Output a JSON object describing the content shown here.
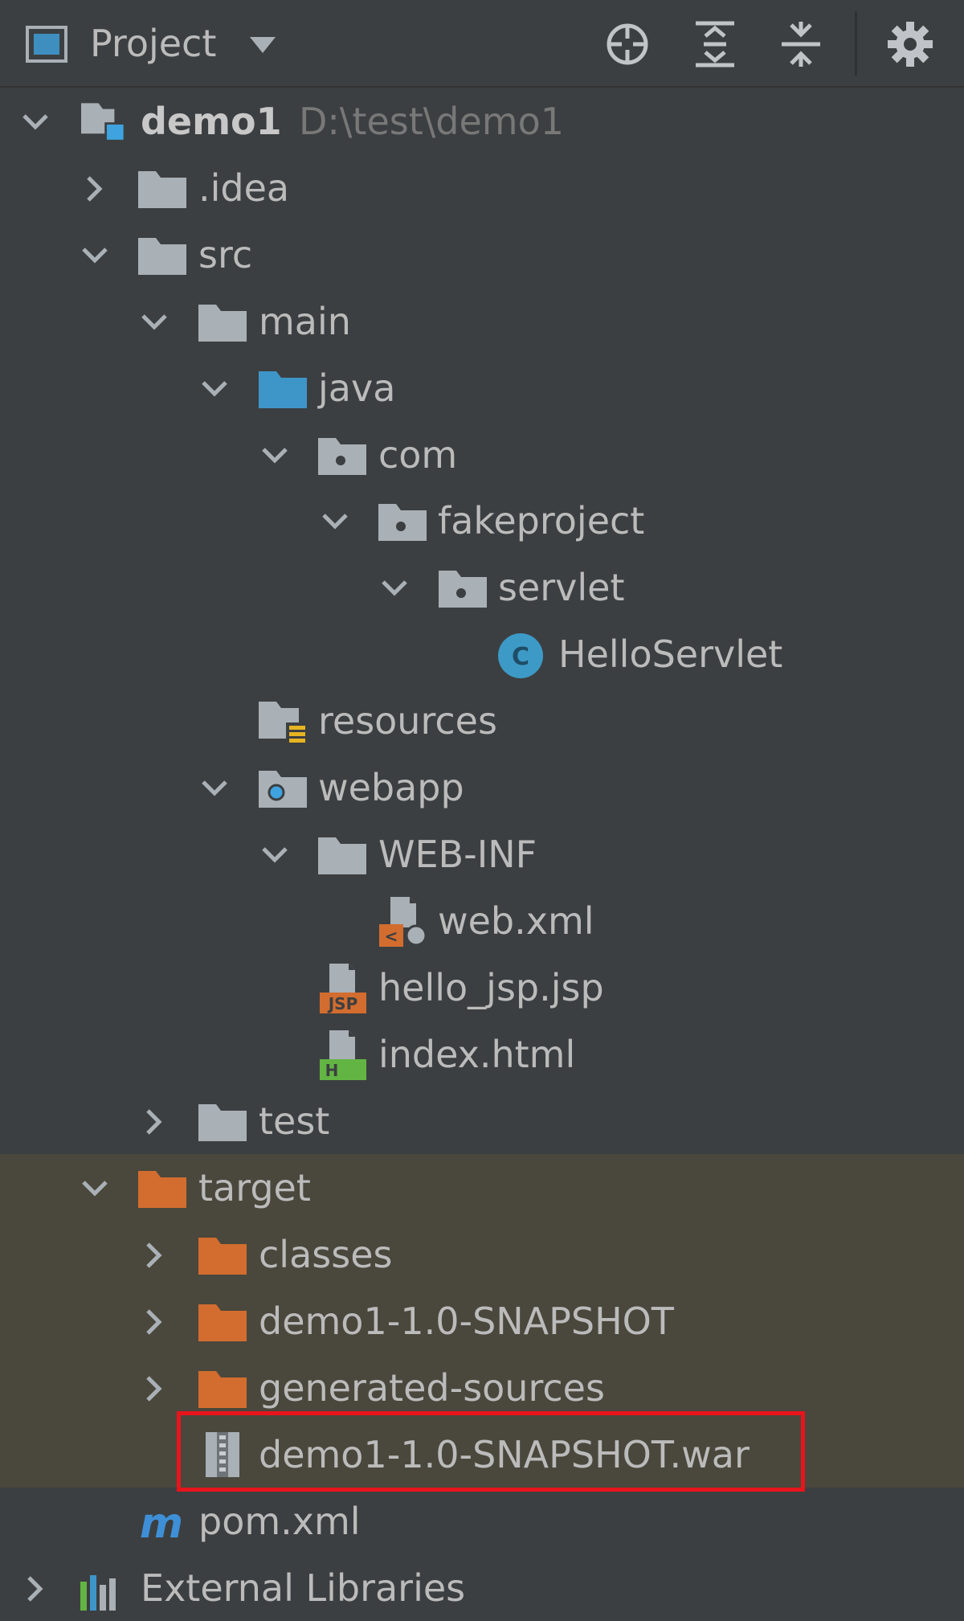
{
  "toolbar": {
    "title": "Project",
    "buttons": [
      "locate-icon",
      "expand-all-icon",
      "collapse-all-icon",
      "gear-icon"
    ]
  },
  "tree": {
    "root": {
      "label": "demo1",
      "path": "D:\\test\\demo1"
    },
    "idea": ".idea",
    "src": "src",
    "main": "main",
    "java": "java",
    "com": "com",
    "fakeproject": "fakeproject",
    "servlet": "servlet",
    "hello_servlet": "HelloServlet",
    "resources": "resources",
    "webapp": "webapp",
    "web_inf": "WEB-INF",
    "web_xml": "web.xml",
    "hello_jsp": "hello_jsp.jsp",
    "index_html": "index.html",
    "test": "test",
    "target": "target",
    "classes": "classes",
    "snapshot_dir": "demo1-1.0-SNAPSHOT",
    "generated_sources": "generated-sources",
    "snapshot_war": "demo1-1.0-SNAPSHOT.war",
    "pom": "pom.xml",
    "external_libraries": "External Libraries"
  },
  "colors": {
    "background": "#3c3f41",
    "excluded_background": "#4a473c",
    "folder_gray": "#a9b0b6",
    "folder_blue": "#3e95c8",
    "folder_orange": "#d26d2f",
    "class_icon": "#3d9ac6",
    "highlight": "#e8141c"
  }
}
